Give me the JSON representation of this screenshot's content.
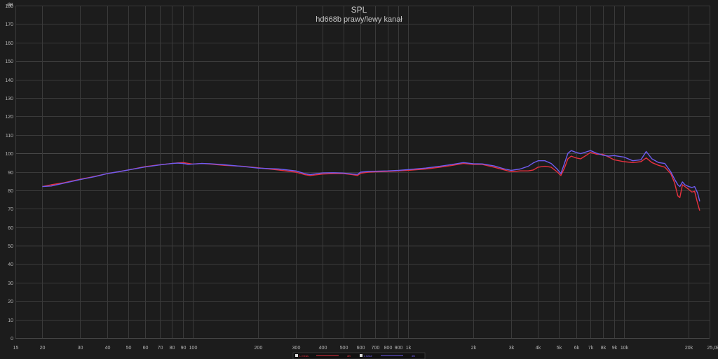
{
  "chart_data": {
    "type": "line",
    "title": "SPL",
    "subtitle": "hd668b prawy/lewy kanał",
    "ylabel": "dB",
    "xlabel": "Hz",
    "x_scale": "log",
    "xlim": [
      15,
      25000
    ],
    "ylim": [
      0,
      180
    ],
    "y_ticks": [
      0,
      10,
      20,
      30,
      40,
      50,
      60,
      70,
      80,
      90,
      100,
      110,
      120,
      130,
      140,
      150,
      160,
      170,
      180
    ],
    "x_ticks": [
      {
        "value": 15,
        "label": "15"
      },
      {
        "value": 20,
        "label": "20"
      },
      {
        "value": 30,
        "label": "30"
      },
      {
        "value": 40,
        "label": "40"
      },
      {
        "value": 50,
        "label": "50"
      },
      {
        "value": 60,
        "label": "60"
      },
      {
        "value": 70,
        "label": "70"
      },
      {
        "value": 80,
        "label": "80"
      },
      {
        "value": 90,
        "label": "90"
      },
      {
        "value": 100,
        "label": "100"
      },
      {
        "value": 200,
        "label": "200"
      },
      {
        "value": 300,
        "label": "300"
      },
      {
        "value": 400,
        "label": "400"
      },
      {
        "value": 500,
        "label": "500"
      },
      {
        "value": 600,
        "label": "600"
      },
      {
        "value": 700,
        "label": "700"
      },
      {
        "value": 800,
        "label": "800"
      },
      {
        "value": 900,
        "label": "900"
      },
      {
        "value": 1000,
        "label": "1k"
      },
      {
        "value": 2000,
        "label": "2k"
      },
      {
        "value": 3000,
        "label": "3k"
      },
      {
        "value": 4000,
        "label": "4k"
      },
      {
        "value": 5000,
        "label": "5k"
      },
      {
        "value": 6000,
        "label": "6k"
      },
      {
        "value": 7000,
        "label": "7k"
      },
      {
        "value": 8000,
        "label": "8k"
      },
      {
        "value": 9000,
        "label": "9k"
      },
      {
        "value": 10000,
        "label": "10k"
      },
      {
        "value": 20000,
        "label": "20k"
      },
      {
        "value": 25000,
        "label": "25,0k Hz"
      }
    ],
    "grid": true,
    "legend_position": "bottom-center",
    "colors": {
      "background": "#1c1c1c",
      "grid": "#3a3a3a",
      "text": "#b5b5b5"
    },
    "series": [
      {
        "name": "L meas",
        "legend_extra": "dB",
        "color": "#e8303e",
        "points": [
          [
            20,
            82
          ],
          [
            22,
            83
          ],
          [
            25,
            84
          ],
          [
            30,
            86
          ],
          [
            35,
            87.5
          ],
          [
            40,
            89
          ],
          [
            45,
            90
          ],
          [
            50,
            91
          ],
          [
            60,
            92.8
          ],
          [
            70,
            93.8
          ],
          [
            80,
            94.5
          ],
          [
            85,
            94.8
          ],
          [
            90,
            95
          ],
          [
            95,
            94.6
          ],
          [
            100,
            94.2
          ],
          [
            110,
            94.5
          ],
          [
            120,
            94.2
          ],
          [
            140,
            93.5
          ],
          [
            170,
            93
          ],
          [
            200,
            92.2
          ],
          [
            250,
            91
          ],
          [
            300,
            89.8
          ],
          [
            330,
            88.5
          ],
          [
            350,
            88
          ],
          [
            400,
            88.8
          ],
          [
            450,
            89
          ],
          [
            500,
            89
          ],
          [
            550,
            88.5
          ],
          [
            580,
            88
          ],
          [
            600,
            89.2
          ],
          [
            650,
            89.8
          ],
          [
            700,
            90
          ],
          [
            800,
            90.2
          ],
          [
            900,
            90.5
          ],
          [
            1000,
            90.8
          ],
          [
            1200,
            91.5
          ],
          [
            1400,
            92.5
          ],
          [
            1600,
            93.5
          ],
          [
            1800,
            94.5
          ],
          [
            2000,
            94
          ],
          [
            2200,
            94
          ],
          [
            2500,
            92.5
          ],
          [
            2800,
            91
          ],
          [
            3000,
            90
          ],
          [
            3300,
            90.5
          ],
          [
            3600,
            90.5
          ],
          [
            3800,
            91
          ],
          [
            4000,
            92.5
          ],
          [
            4300,
            93
          ],
          [
            4600,
            92.5
          ],
          [
            4900,
            90
          ],
          [
            5100,
            88
          ],
          [
            5300,
            92
          ],
          [
            5500,
            97
          ],
          [
            5700,
            98.5
          ],
          [
            6000,
            97.5
          ],
          [
            6300,
            97
          ],
          [
            6700,
            99
          ],
          [
            7000,
            100.5
          ],
          [
            7500,
            99.5
          ],
          [
            8000,
            99.5
          ],
          [
            8500,
            98
          ],
          [
            9000,
            96.5
          ],
          [
            10000,
            95.5
          ],
          [
            11000,
            95
          ],
          [
            12000,
            95.5
          ],
          [
            12700,
            97.5
          ],
          [
            13500,
            95
          ],
          [
            14500,
            93.5
          ],
          [
            15500,
            92.5
          ],
          [
            16500,
            89
          ],
          [
            17200,
            84
          ],
          [
            17800,
            77
          ],
          [
            18200,
            76
          ],
          [
            18700,
            83
          ],
          [
            19200,
            82
          ],
          [
            20000,
            80.5
          ],
          [
            20700,
            79
          ],
          [
            21300,
            79.5
          ],
          [
            22000,
            73
          ],
          [
            22500,
            69
          ]
        ]
      },
      {
        "name": "L base",
        "legend_extra": "dB",
        "color": "#6f5cf0",
        "points": [
          [
            20,
            82
          ],
          [
            22,
            82.3
          ],
          [
            25,
            83.8
          ],
          [
            30,
            85.8
          ],
          [
            35,
            87.4
          ],
          [
            40,
            89
          ],
          [
            45,
            90
          ],
          [
            50,
            91
          ],
          [
            60,
            92.6
          ],
          [
            70,
            93.7
          ],
          [
            80,
            94.5
          ],
          [
            85,
            94.7
          ],
          [
            90,
            94.5
          ],
          [
            95,
            94
          ],
          [
            100,
            94.2
          ],
          [
            110,
            94.5
          ],
          [
            120,
            94.4
          ],
          [
            140,
            93.8
          ],
          [
            170,
            92.9
          ],
          [
            200,
            92
          ],
          [
            250,
            91.5
          ],
          [
            300,
            90.5
          ],
          [
            330,
            89
          ],
          [
            350,
            88.5
          ],
          [
            400,
            89.4
          ],
          [
            450,
            89.5
          ],
          [
            500,
            89.3
          ],
          [
            550,
            88.8
          ],
          [
            580,
            88.6
          ],
          [
            600,
            89.8
          ],
          [
            650,
            90.2
          ],
          [
            700,
            90.3
          ],
          [
            800,
            90.5
          ],
          [
            900,
            90.8
          ],
          [
            1000,
            91.2
          ],
          [
            1200,
            92
          ],
          [
            1400,
            93
          ],
          [
            1600,
            94
          ],
          [
            1800,
            95
          ],
          [
            2000,
            94.4
          ],
          [
            2200,
            94.3
          ],
          [
            2500,
            93.2
          ],
          [
            2800,
            91.5
          ],
          [
            3000,
            90.8
          ],
          [
            3300,
            91.5
          ],
          [
            3600,
            93
          ],
          [
            3800,
            94.8
          ],
          [
            4000,
            96
          ],
          [
            4300,
            96
          ],
          [
            4600,
            94.5
          ],
          [
            4900,
            91.5
          ],
          [
            5100,
            89
          ],
          [
            5300,
            94.5
          ],
          [
            5500,
            100
          ],
          [
            5700,
            101.5
          ],
          [
            6000,
            100.5
          ],
          [
            6300,
            99.8
          ],
          [
            6700,
            100.8
          ],
          [
            7000,
            101.5
          ],
          [
            7500,
            100
          ],
          [
            8000,
            99
          ],
          [
            8500,
            98.5
          ],
          [
            9000,
            98.8
          ],
          [
            10000,
            98
          ],
          [
            11000,
            96
          ],
          [
            12000,
            96.5
          ],
          [
            12700,
            101
          ],
          [
            13500,
            97
          ],
          [
            14500,
            95
          ],
          [
            15500,
            94.5
          ],
          [
            16500,
            90
          ],
          [
            17200,
            86
          ],
          [
            17800,
            83
          ],
          [
            18200,
            82
          ],
          [
            18700,
            84.5
          ],
          [
            19200,
            83
          ],
          [
            20000,
            82
          ],
          [
            20700,
            81.5
          ],
          [
            21300,
            82
          ],
          [
            22000,
            78.5
          ],
          [
            22500,
            74
          ]
        ]
      }
    ]
  }
}
